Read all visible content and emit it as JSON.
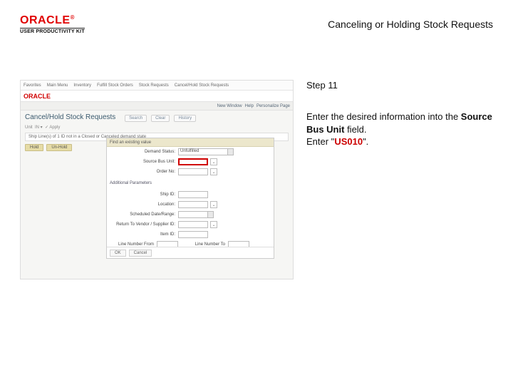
{
  "logo": {
    "text": "ORACLE",
    "reg": "®",
    "sub": "USER PRODUCTIVITY KIT"
  },
  "title": "Canceling or Holding Stock Requests",
  "step_label": "Step 11",
  "instruction": {
    "line1a": "Enter the desired information into the ",
    "bold": "Source Bus Unit",
    "line1b": " field.",
    "line2a": "Enter \"",
    "value": "US010",
    "line2b": "\"."
  },
  "shot": {
    "brand": "ORACLE",
    "nav": [
      "Favorites",
      "Main Menu",
      "Inventory",
      "Fulfill Stock Orders",
      "Stock Requests",
      "Cancel/Hold Stock Requests"
    ],
    "subbar": [
      "New Window",
      "Help",
      "Personalize Page"
    ],
    "page_title": "Cancel/Hold Stock Requests",
    "btns": [
      "Search",
      "Clear",
      "History"
    ],
    "strip": "Ship Line(s) of 1 ID not in a Closed or Canceled demand state",
    "chips": [
      "Hold",
      "Un-Hold"
    ],
    "panel_header": "Find an existing value",
    "labels": {
      "demand_status": "Demand Status:",
      "source_bus": "Source Bus Unit:",
      "order_no": "Order No:",
      "next_hdr": "Additional Parameters",
      "ship_id": "Ship ID:",
      "location": "Location:",
      "sched_line": "Scheduled Date/Range:",
      "ret_vendor": "Return To Vendor / Supplier ID:",
      "item_id": "Item ID:",
      "line_from": "Line Number From",
      "line_to": "Line Number To"
    },
    "status_val": "Unfulfilled",
    "foot": [
      "OK",
      "Cancel"
    ]
  }
}
